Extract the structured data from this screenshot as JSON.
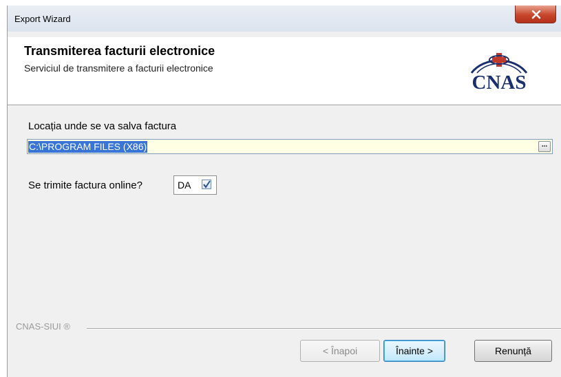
{
  "window": {
    "title": "Export Wizard"
  },
  "header": {
    "title": "Transmiterea facturii electronice",
    "subtitle": "Serviciul de transmitere a facturii electronice",
    "logo_text": "CNAS"
  },
  "form": {
    "location_label": "Locația unde se va salva factura",
    "location_value": "C:\\PROGRAM FILES (X86)",
    "browse_label": "...",
    "online_label": "Se trimite factura online?",
    "online_value": "DA",
    "online_checked": true
  },
  "footer": {
    "brand": "CNAS-SIUI ®"
  },
  "buttons": {
    "back": "< Înapoi",
    "next": "Înainte >",
    "cancel": "Renunță"
  },
  "colors": {
    "logo_blue": "#1b2f6e",
    "logo_red": "#c0392b",
    "selection": "#3875d7",
    "input_bg": "#ffffe4"
  }
}
